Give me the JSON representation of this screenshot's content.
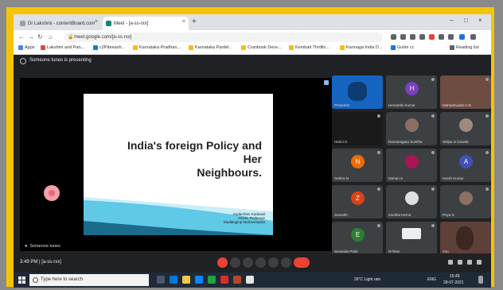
{
  "browser": {
    "tabs": [
      {
        "label": "Dr Lakshmi - contentBoard.com",
        "active": false,
        "fav_color": "#9aa0a6"
      },
      {
        "label": "Meet - [a-ss-rxx]",
        "active": true,
        "fav_color": "#00897b"
      }
    ],
    "new_tab": "+",
    "close_glyph": "×",
    "window_controls": [
      "–",
      "□",
      "×"
    ],
    "url": "meet.google.com/[a-ss-rxx]",
    "bookmarks": [
      {
        "label": "Apps",
        "color": "#4285f4"
      },
      {
        "label": "Lakshmi and Pan...",
        "color": "#ea4335"
      },
      {
        "label": "c2Ptteeash...",
        "color": "#1a73e8"
      },
      {
        "label": "Karnataka Pradhan...",
        "color": "#fbbc04"
      },
      {
        "label": "Karnataka Pardel...",
        "color": "#fbbc04"
      },
      {
        "label": "Cranbook Dece...",
        "color": "#fbbc04"
      },
      {
        "label": "Kembalt Thrdlin...",
        "color": "#fbbc04"
      },
      {
        "label": "Kannaga India D...",
        "color": "#fbbc04"
      },
      {
        "label": "Gulim cc",
        "color": "#1a73e8"
      },
      {
        "label": "Reading list",
        "color": "#5f6368"
      }
    ]
  },
  "meet": {
    "top_label": "Someone tunes is presenting",
    "slide": {
      "title_line1": "India's foreign Policy and Her",
      "title_line2": "Neighbours.",
      "credit1": "Sudarshan Kaduwal",
      "credit2": "Assist. Professor",
      "credit3": "Mudalagirip Mahavirtiyalia",
      "colors": {
        "band_dark": "#1b6c8c",
        "band_light": "#5fc9e6",
        "band_pale": "#c9eef8"
      }
    },
    "presenter_caption": "Someone tunes",
    "participants": [
      {
        "name": "Presenter",
        "initial": "",
        "color": "#1565c0",
        "type": "video"
      },
      {
        "name": "Hemanthi Kumar",
        "initial": "H",
        "color": "#7b3fbf",
        "type": "avatar"
      },
      {
        "name": "Mahadevaiah H.B.",
        "initial": "",
        "color": "#6d4c41",
        "type": "photo"
      },
      {
        "name": "Harini G",
        "initial": "",
        "color": "#1a1a1a",
        "type": "dark"
      },
      {
        "name": "Ramanagara Sunitha",
        "initial": "",
        "color": "#8d6e63",
        "type": "photo"
      },
      {
        "name": "Shilpa D Gowda",
        "initial": "",
        "color": "#a1887f",
        "type": "photo"
      },
      {
        "name": "Nethra N",
        "initial": "N",
        "color": "#ef6c00",
        "type": "avatar"
      },
      {
        "name": "Mohan S",
        "initial": "",
        "color": "#ad1457",
        "type": "avatar"
      },
      {
        "name": "Harsh Kumar",
        "initial": "A",
        "color": "#3f51b5",
        "type": "avatar"
      },
      {
        "name": "Sumathi",
        "initial": "Z",
        "color": "#d84315",
        "type": "avatar"
      },
      {
        "name": "Kavitha Hema",
        "initial": "",
        "color": "#e0e0e0",
        "type": "photo"
      },
      {
        "name": "Priya N",
        "initial": "",
        "color": "#8d6e63",
        "type": "photo"
      },
      {
        "name": "Sunanda Patel",
        "initial": "E",
        "color": "#2e7d32",
        "type": "avatar"
      },
      {
        "name": "M Ravi",
        "initial": "",
        "color": "#37474f",
        "type": "logo"
      },
      {
        "name": "You",
        "initial": "",
        "color": "#5d4037",
        "type": "video"
      }
    ],
    "time": "3:49 PM",
    "meeting_code": "[a-ss-rxx]",
    "bottom_controls_colors": {
      "mic_off": "#ea4335",
      "end_call": "#ea4335"
    }
  },
  "taskbar": {
    "search_placeholder": "Type here to search",
    "tray_weather": "26°C Light rain",
    "tray_lang": "ENG",
    "tray_time": "15:49",
    "tray_date": "28-07-2021"
  }
}
